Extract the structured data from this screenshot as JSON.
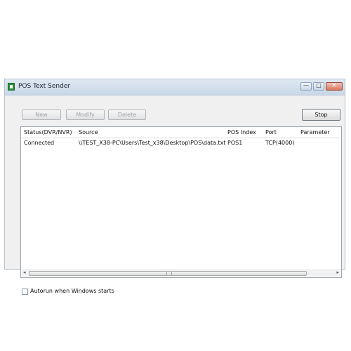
{
  "window": {
    "title": "POS Text Sender",
    "icon": "app-icon",
    "controls": {
      "minimize_glyph": "—",
      "maximize_glyph": "□",
      "close_glyph": "×"
    }
  },
  "toolbar": {
    "new_label": "New",
    "modify_label": "Modify",
    "delete_label": "Delete",
    "stop_label": "Stop"
  },
  "table": {
    "columns": [
      "Status(DVR/NVR)",
      "Source",
      "POS Index",
      "Port",
      "Parameter"
    ],
    "rows": [
      [
        "Connected",
        "\\\\TEST_X38-PC\\Users\\Test_x38\\Desktop\\POS\\data.txt",
        "POS1",
        "TCP(4000)",
        ""
      ]
    ]
  },
  "scrollbar": {
    "left_arrow": "◂",
    "right_arrow": "▸"
  },
  "options": {
    "autorun_label": "Autorun when Windows starts",
    "autorun_checked": false
  }
}
